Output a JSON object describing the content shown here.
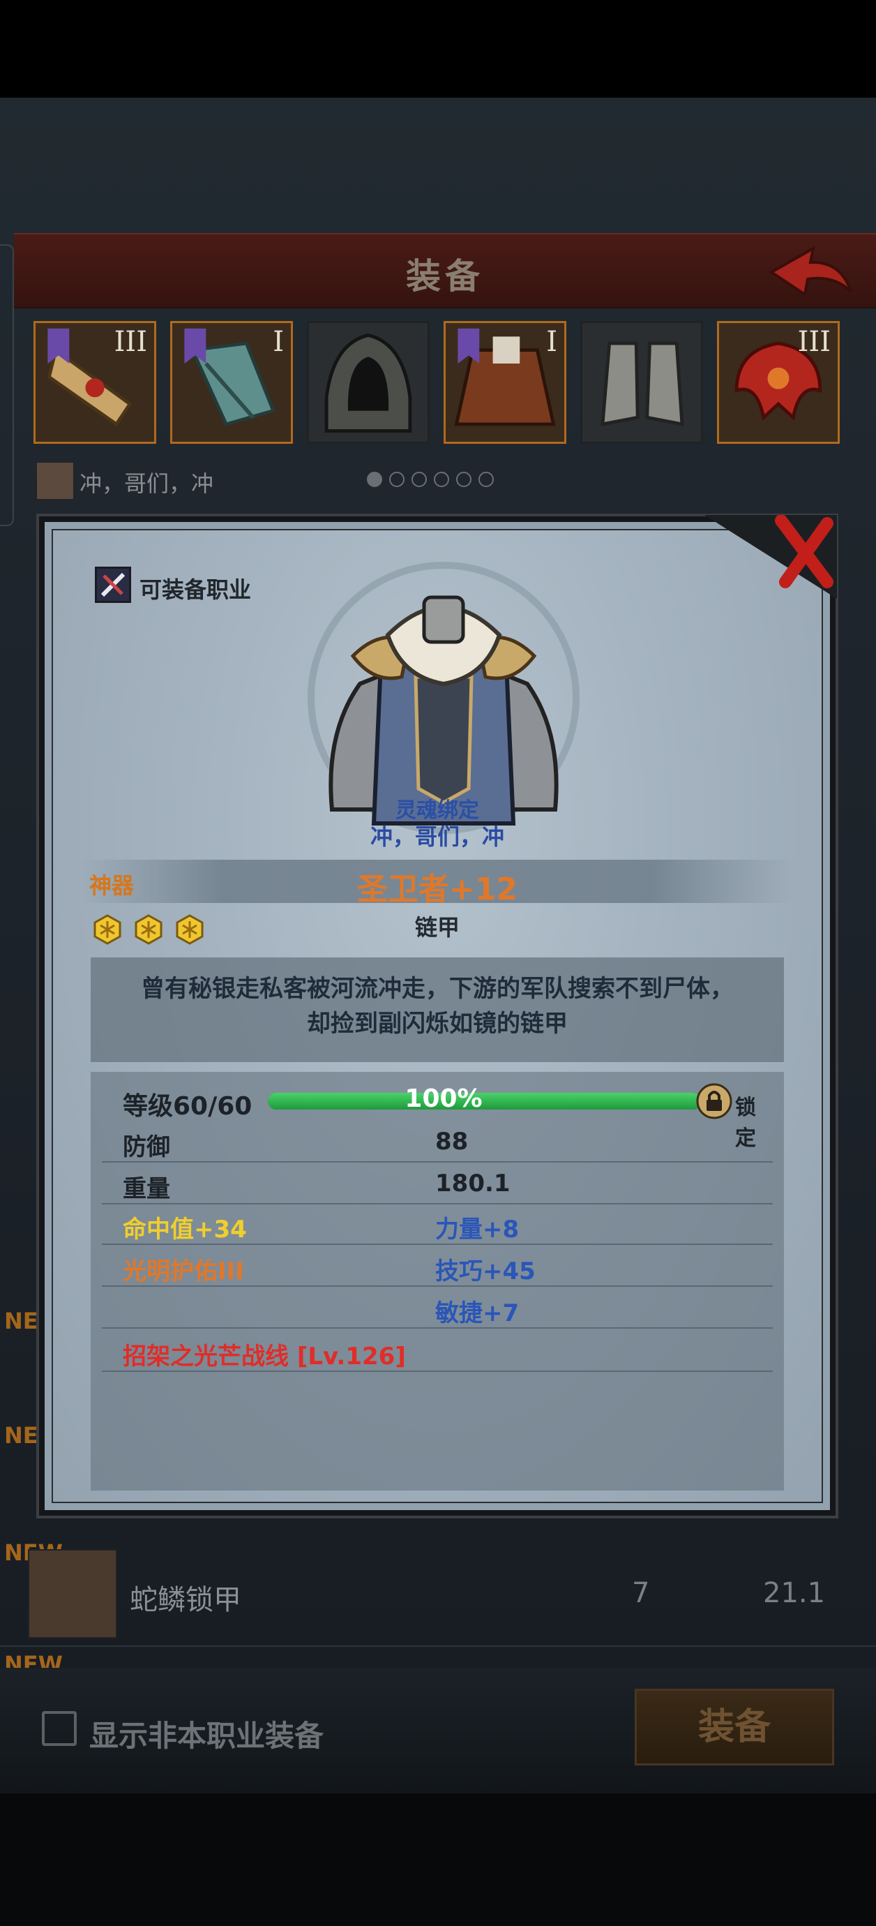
{
  "header": {
    "title": "装备"
  },
  "slots": [
    {
      "tier": "III",
      "highlighted": true
    },
    {
      "tier": "I",
      "highlighted": true
    },
    {
      "tier": "",
      "highlighted": false
    },
    {
      "tier": "I",
      "highlighted": true
    },
    {
      "tier": "",
      "highlighted": false
    },
    {
      "tier": "III",
      "highlighted": true
    }
  ],
  "set_bar": {
    "name": "冲，哥们，冲",
    "page_count": 6,
    "active_page": 1
  },
  "background_list": {
    "new_tags": [
      "NEW",
      "NEW",
      "NEW",
      "NEW"
    ],
    "row": {
      "name": "蛇鳞锁甲",
      "col1": "7",
      "col2": "21.1"
    }
  },
  "footer": {
    "checkbox_label": "显示非本职业装备",
    "equip_button": "装备"
  },
  "modal": {
    "class_label": "可装备职业",
    "bound_text": "灵魂绑定",
    "set_name": "冲，哥们，冲",
    "rarity": "神器",
    "item_name": "圣卫者+12",
    "item_type": "链甲",
    "stars": 3,
    "lore_line1": "曾有秘银走私客被河流冲走，下游的军队搜索不到尸体，",
    "lore_line2": "却捡到副闪烁如镜的链甲",
    "level": {
      "label": "等级60/60",
      "percent_text": "100%",
      "fill": 1.0,
      "lock_label": "锁定"
    },
    "stats": [
      {
        "label": "防御",
        "value": "88"
      },
      {
        "label": "重量",
        "value": "180.1"
      },
      {
        "label": "命中值+34",
        "value": "力量+8"
      },
      {
        "label": "光明护佑III",
        "value": "技巧+45"
      },
      {
        "label": "",
        "value": "敏捷+7"
      }
    ],
    "skill": "招架之光芒战线 [Lv.126]"
  },
  "colors": {
    "rarity": "#e0782a",
    "gold_stat": "#f0cf2d",
    "blue_stat": "#2a56b8",
    "skill": "#e02d28",
    "progress": "#1e9a3b"
  }
}
